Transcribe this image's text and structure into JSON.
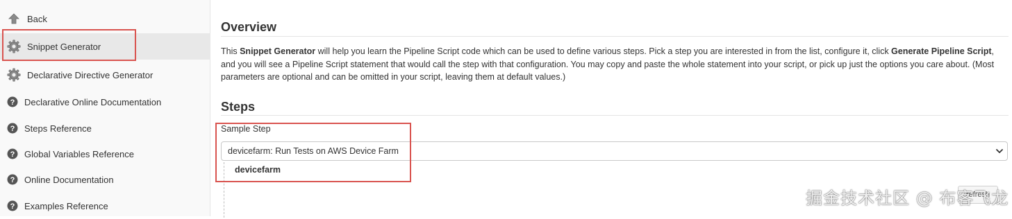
{
  "sidebar": {
    "items": [
      {
        "label": "Back",
        "icon": "up-arrow-icon"
      },
      {
        "label": "Snippet Generator",
        "icon": "gear-icon"
      },
      {
        "label": "Declarative Directive Generator",
        "icon": "gear-icon"
      },
      {
        "label": "Declarative Online Documentation",
        "icon": "help-icon"
      },
      {
        "label": "Steps Reference",
        "icon": "help-icon"
      },
      {
        "label": "Global Variables Reference",
        "icon": "help-icon"
      },
      {
        "label": "Online Documentation",
        "icon": "help-icon"
      },
      {
        "label": "Examples Reference",
        "icon": "help-icon"
      }
    ]
  },
  "overview": {
    "title": "Overview",
    "text_parts": [
      "This ",
      "Snippet Generator",
      " will help you learn the Pipeline Script code which can be used to define various steps. Pick a step you are interested in from the list, configure it, click ",
      "Generate Pipeline Script",
      ", and you will see a Pipeline Script statement that would call the step with that configuration. You may copy and paste the whole statement into your script, or pick up just the options you care about. (Most parameters are optional and can be omitted in your script, leaving them at default values.)"
    ]
  },
  "steps": {
    "title": "Steps",
    "sample_step_label": "Sample Step",
    "selected_value": "devicefarm: Run Tests on AWS Device Farm",
    "sub_step": "devicefarm",
    "help_button": "refresh"
  },
  "watermark": "掘金技术社区 @ 布客飞龙",
  "colors": {
    "highlight": "#d9534f",
    "sidebar_bg": "#f9f9f9",
    "active_bg": "#e8e8e8"
  }
}
